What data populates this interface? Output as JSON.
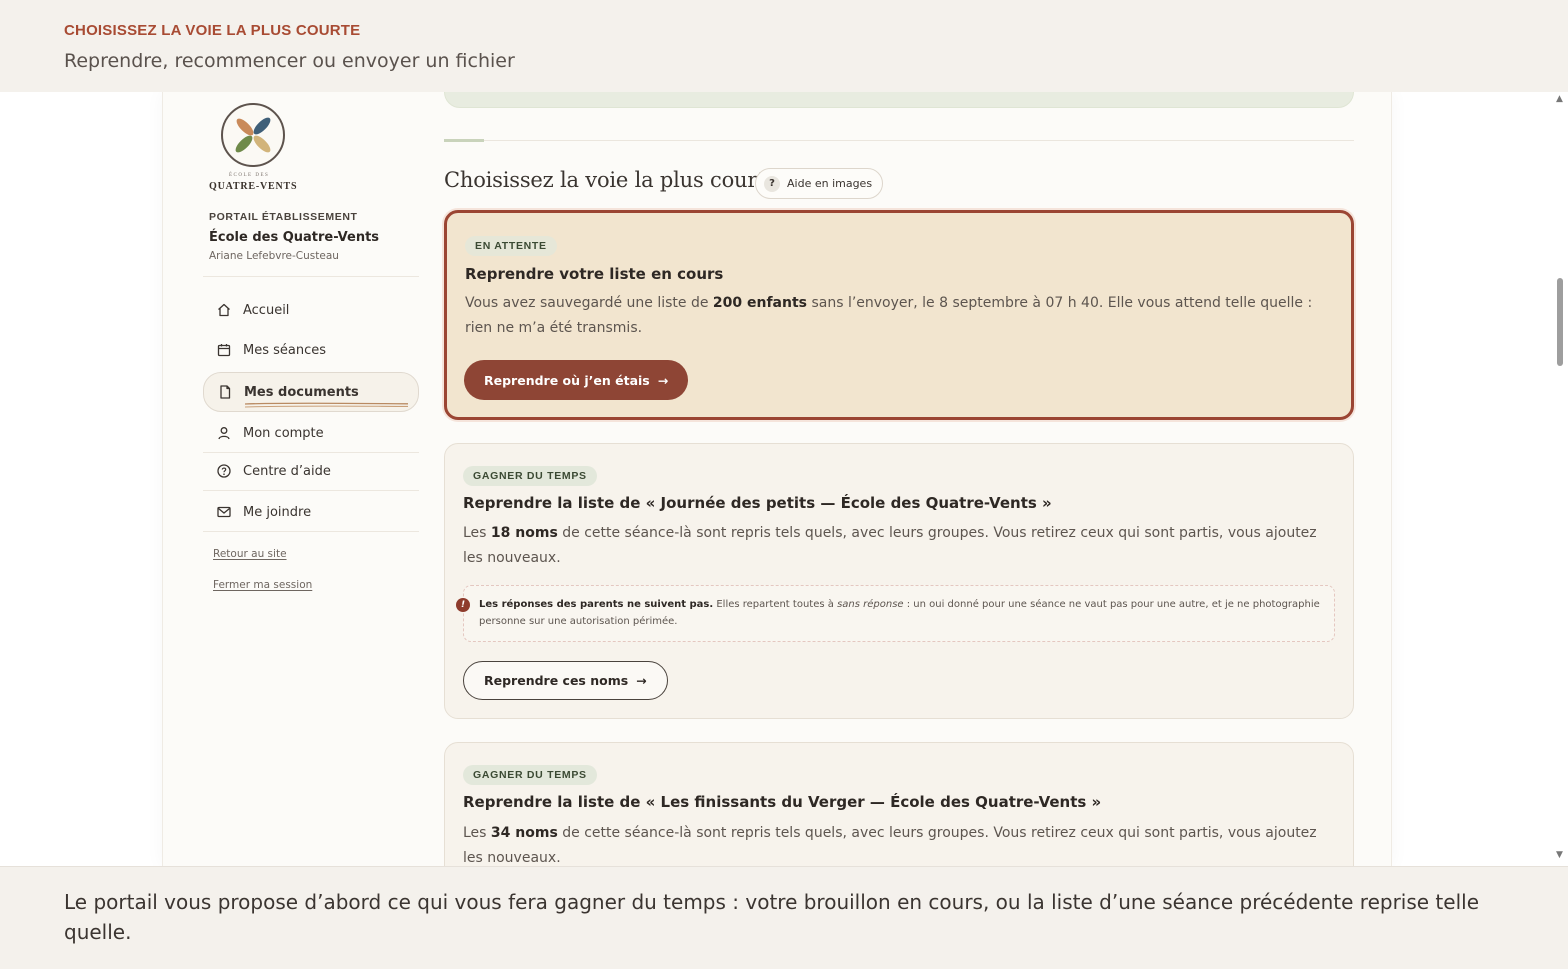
{
  "caption": {
    "eyebrow": "CHOISISSEZ LA VOIE LA PLUS COURTE",
    "subtitle": "Reprendre, recommencer ou envoyer un fichier",
    "bottom": "Le portail vous propose d’abord ce qui vous fera gagner du temps : votre brouillon en cours, ou la liste d’une séance précédente reprise telle quelle."
  },
  "logo": {
    "small": "ÉCOLE DES",
    "name": "QUATRE-VENTS",
    "icon": "pinwheel-logo"
  },
  "sidebar": {
    "eyebrow": "PORTAIL ÉTABLISSEMENT",
    "school": "École des Quatre-Vents",
    "user": "Ariane Lefebvre-Custeau",
    "nav": [
      {
        "label": "Accueil",
        "icon": "home-icon"
      },
      {
        "label": "Mes séances",
        "icon": "calendar-icon"
      },
      {
        "label": "Mes documents",
        "icon": "document-icon",
        "active": true
      },
      {
        "label": "Mon compte",
        "icon": "user-icon"
      },
      {
        "label": "Centre d’aide",
        "icon": "help-circle-icon"
      },
      {
        "label": "Me joindre",
        "icon": "mail-icon"
      }
    ],
    "links": [
      "Retour au site",
      "Fermer ma session"
    ]
  },
  "main": {
    "section_title": "Choisissez la voie la plus courte",
    "help_button": {
      "icon_glyph": "?",
      "label": "Aide en images"
    },
    "pending_card": {
      "badge": "EN ATTENTE",
      "title": "Reprendre votre liste en cours",
      "body_1": "Vous avez sauvegardé une liste de ",
      "body_bold": "200 enfants",
      "body_2": " sans l’envoyer, le 8 septembre à 07 h 40. Elle vous attend telle quelle : rien ne m’a été transmis.",
      "button": "Reprendre où j’en étais",
      "button_arrow": "→"
    },
    "option_cards": [
      {
        "badge": "GAGNER DU TEMPS",
        "title": "Reprendre la liste de « Journée des petits — École des Quatre-Vents »",
        "body_1": "Les ",
        "body_bold": "18 noms",
        "body_2": " de cette séance-là sont repris tels quels, avec leurs groupes. Vous retirez ceux qui sont partis, vous ajoutez les nouveaux.",
        "warning_icon": "!",
        "warning_bold": "Les réponses des parents ne suivent pas.",
        "warning_1": " Elles repartent toutes à ",
        "warning_italic": "sans réponse",
        "warning_2": " : un oui donné pour une séance ne vaut pas pour une autre, et je ne photographie personne sur une autorisation périmée.",
        "button": "Reprendre ces noms",
        "button_arrow": "→"
      },
      {
        "badge": "GAGNER DU TEMPS",
        "title": "Reprendre la liste de « Les finissants du Verger — École des Quatre-Vents »",
        "body_1": "Les ",
        "body_bold": "34 noms",
        "body_2": " de cette séance-là sont repris tels quels, avec leurs groupes. Vous retirez ceux qui sont partis, vous ajoutez les nouveaux."
      }
    ]
  },
  "colors": {
    "accent": "#8e4535",
    "band": "#f4f1ec",
    "pending_bg": "#f2e5cf",
    "badge_bg": "#e3e8db"
  }
}
